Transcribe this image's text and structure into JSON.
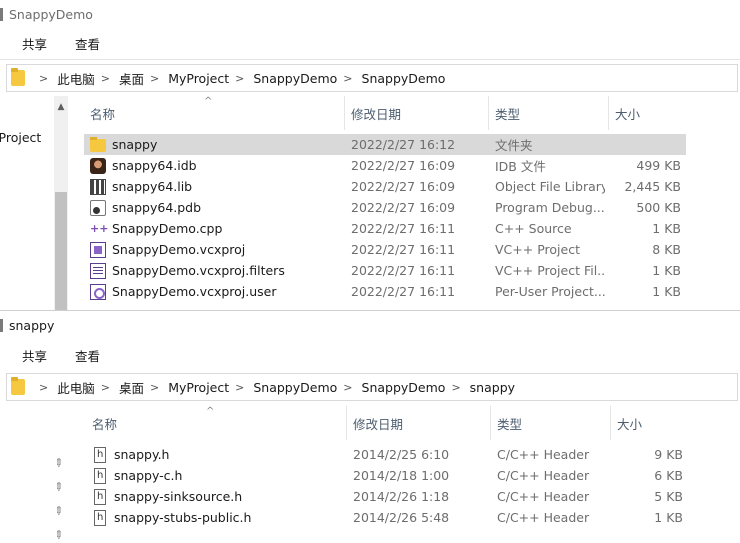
{
  "window1": {
    "title": "SnappyDemo",
    "ribbon_tabs": [
      "共享",
      "查看"
    ],
    "breadcrumb": [
      "此电脑",
      "桌面",
      "MyProject",
      "SnappyDemo",
      "SnappyDemo"
    ],
    "nav_label": "zProject",
    "columns": [
      "名称",
      "修改日期",
      "类型",
      "大小"
    ],
    "files": [
      {
        "name": "snappy",
        "date": "2022/2/27 16:12",
        "type": "文件夹",
        "size": "",
        "icon": "folder-icon",
        "selected": true
      },
      {
        "name": "snappy64.idb",
        "date": "2022/2/27 16:09",
        "type": "IDB 文件",
        "size": "499 KB",
        "icon": "idb-file-icon"
      },
      {
        "name": "snappy64.lib",
        "date": "2022/2/27 16:09",
        "type": "Object File Library",
        "size": "2,445 KB",
        "icon": "lib-file-icon"
      },
      {
        "name": "snappy64.pdb",
        "date": "2022/2/27 16:09",
        "type": "Program Debug...",
        "size": "500 KB",
        "icon": "pdb-file-icon"
      },
      {
        "name": "SnappyDemo.cpp",
        "date": "2022/2/27 16:11",
        "type": "C++ Source",
        "size": "1 KB",
        "icon": "cpp-file-icon"
      },
      {
        "name": "SnappyDemo.vcxproj",
        "date": "2022/2/27 16:11",
        "type": "VC++ Project",
        "size": "8 KB",
        "icon": "vcxproj-file-icon"
      },
      {
        "name": "SnappyDemo.vcxproj.filters",
        "date": "2022/2/27 16:11",
        "type": "VC++ Project Fil...",
        "size": "1 KB",
        "icon": "filters-file-icon"
      },
      {
        "name": "SnappyDemo.vcxproj.user",
        "date": "2022/2/27 16:11",
        "type": "Per-User Project...",
        "size": "1 KB",
        "icon": "user-file-icon"
      }
    ]
  },
  "window2": {
    "title": "snappy",
    "ribbon_tabs": [
      "共享",
      "查看"
    ],
    "breadcrumb": [
      "此电脑",
      "桌面",
      "MyProject",
      "SnappyDemo",
      "SnappyDemo",
      "snappy"
    ],
    "columns": [
      "名称",
      "修改日期",
      "类型",
      "大小"
    ],
    "files": [
      {
        "name": "snappy.h",
        "date": "2014/2/25 6:10",
        "type": "C/C++ Header",
        "size": "9 KB",
        "icon": "header-file-icon"
      },
      {
        "name": "snappy-c.h",
        "date": "2014/2/18 1:00",
        "type": "C/C++ Header",
        "size": "6 KB",
        "icon": "header-file-icon"
      },
      {
        "name": "snappy-sinksource.h",
        "date": "2014/2/26 1:18",
        "type": "C/C++ Header",
        "size": "5 KB",
        "icon": "header-file-icon"
      },
      {
        "name": "snappy-stubs-public.h",
        "date": "2014/2/26 5:48",
        "type": "C/C++ Header",
        "size": "1 KB",
        "icon": "header-file-icon"
      }
    ]
  },
  "colors": {
    "selected_row": "#d9d9d9",
    "folder": "#f6c83f",
    "header_text": "#4c5d70"
  }
}
